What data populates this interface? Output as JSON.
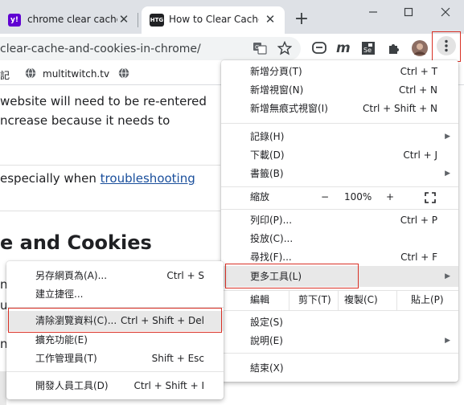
{
  "tabs": [
    {
      "title": "chrome clear cache",
      "favicon": "y!",
      "favicon_color": "#6001d2"
    },
    {
      "title": "How to Clear Cache",
      "favicon": "HTG",
      "favicon_color": "#202124"
    }
  ],
  "address_bar": {
    "url": "clear-cache-and-cookies-in-chrome/"
  },
  "bookmarks": [
    {
      "label": "記"
    },
    {
      "label": "multitwitch.tv"
    }
  ],
  "page": {
    "lines": [
      "website will need to be re-entered",
      "ncrease because it needs to",
      "especially when "
    ],
    "link_text": "troubleshooting",
    "heading": "e and Cookies",
    "fragments": [
      "n",
      "u",
      "n"
    ]
  },
  "main_menu": {
    "items": [
      {
        "label": "新增分頁(T)",
        "shortcut": "Ctrl + T"
      },
      {
        "label": "新增視窗(N)",
        "shortcut": "Ctrl + N"
      },
      {
        "label": "新增無痕式視窗(I)",
        "shortcut": "Ctrl + Shift + N"
      },
      {
        "label": "記錄(H)"
      },
      {
        "label": "下載(D)",
        "shortcut": "Ctrl + J"
      },
      {
        "label": "書籤(B)"
      },
      {
        "label": "列印(P)...",
        "shortcut": "Ctrl + P"
      },
      {
        "label": "投放(C)..."
      },
      {
        "label": "尋找(F)...",
        "shortcut": "Ctrl + F"
      },
      {
        "label": "更多工具(L)"
      },
      {
        "label": "設定(S)"
      },
      {
        "label": "說明(E)"
      },
      {
        "label": "結束(X)"
      }
    ],
    "zoom": {
      "label": "縮放",
      "minus": "−",
      "value": "100%",
      "plus": "+"
    },
    "edit": {
      "label": "編輯",
      "cut": "剪下(T)",
      "copy": "複製(C)",
      "paste": "貼上(P)"
    }
  },
  "submenu": {
    "items": [
      {
        "label": "另存網頁為(A)...",
        "shortcut": "Ctrl + S"
      },
      {
        "label": "建立捷徑..."
      },
      {
        "label": "清除瀏覽資料(C)...",
        "shortcut": "Ctrl + Shift + Del"
      },
      {
        "label": "擴充功能(E)"
      },
      {
        "label": "工作管理員(T)",
        "shortcut": "Shift + Esc"
      },
      {
        "label": "開發人員工具(D)",
        "shortcut": "Ctrl + Shift + I"
      }
    ]
  },
  "colors": {
    "highlight_box": "#d93025",
    "menu_hover": "#e8e8e8",
    "link": "#1a4f9c"
  }
}
